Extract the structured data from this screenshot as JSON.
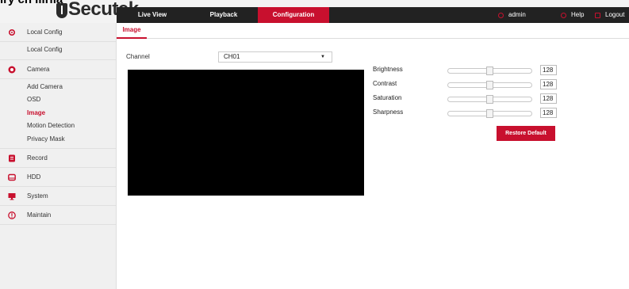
{
  "header": {
    "cutoff_text": "ıry ch llirlıa",
    "brand": "Secutek",
    "nav": {
      "live_view": "Live View",
      "playback": "Playback",
      "configuration": "Configuration"
    },
    "user": "admin",
    "help": "Help",
    "logout": "Logout"
  },
  "sidebar": {
    "local_config_group": "Local Config",
    "local_config_items": [
      "Local Config"
    ],
    "camera_group": "Camera",
    "camera_items": [
      "Add Camera",
      "OSD",
      "Image",
      "Motion Detection",
      "Privacy Mask"
    ],
    "active_item": "Image",
    "record_group": "Record",
    "hdd_group": "HDD",
    "system_group": "System",
    "maintain_group": "Maintain",
    "icons": [
      "gear-icon",
      "camera-icon",
      "record-icon",
      "hdd-icon",
      "monitor-icon",
      "info-icon"
    ]
  },
  "main": {
    "tab_label": "Image",
    "channel_label": "Channel",
    "channel_value": "CH01",
    "adjustments": [
      {
        "label": "Brightness",
        "value": "128",
        "level": 0.5
      },
      {
        "label": "Contrast",
        "value": "128",
        "level": 0.5
      },
      {
        "label": "Saturation",
        "value": "128",
        "level": 0.5
      },
      {
        "label": "Sharpness",
        "value": "128",
        "level": 0.5
      }
    ],
    "restore_label": "Restore Default"
  },
  "colors": {
    "accent": "#c8102e",
    "nav_bg": "#222222",
    "sidebar_bg": "#f0f0f0"
  }
}
